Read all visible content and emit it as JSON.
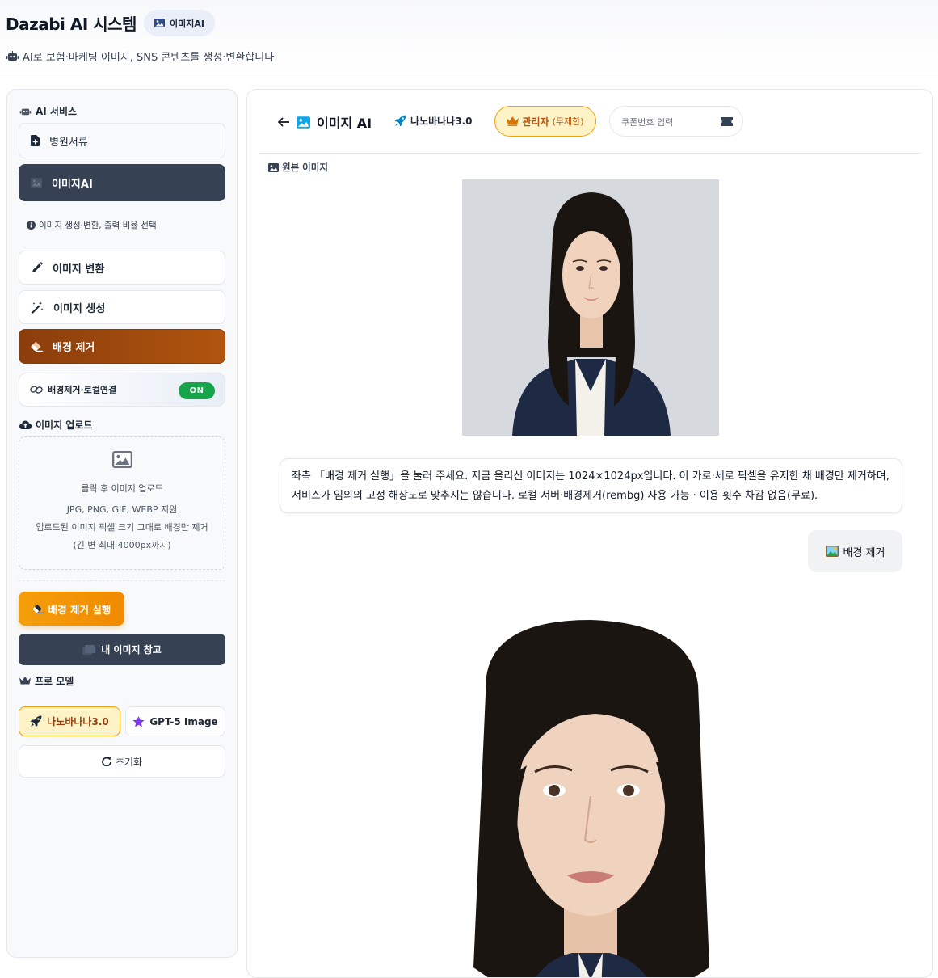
{
  "header": {
    "title": "Dazabi AI 시스템",
    "badge_label": "이미지AI",
    "subtitle": "AI로 보험·마케팅 이미지, SNS 콘텐츠를 생성·변환합니다"
  },
  "sidebar": {
    "services_label": "AI 서비스",
    "menu": {
      "hospital_docs": "병원서류",
      "image_ai": "이미지AI",
      "hint": "이미지 생성·변환, 출력 비율 선택",
      "image_convert": "이미지 변환",
      "image_generate": "이미지 생성",
      "bg_remove": "배경 제거"
    },
    "local_link": {
      "label": "배경제거·로컬연결",
      "state": "ON"
    },
    "upload": {
      "section_label": "이미지 업로드",
      "line1": "클릭 후 이미지 업로드",
      "line2": "JPG, PNG, GIF, WEBP 지원",
      "line3": "업로드된 이미지 픽셀 크기 그대로 배경만 제거",
      "line4": "(긴 변 최대 4000px까지)"
    },
    "run_button": "배경 제거 실행",
    "gallery_button": "내 이미지 창고",
    "pro_label": "프로 모델",
    "models": [
      "나노바나나3.0",
      "GPT-5 Image"
    ],
    "reset_button": "초기화"
  },
  "main": {
    "title": "이미지 AI",
    "model": "나노바나나3.0",
    "admin": {
      "label": "관리자",
      "sub": "(무제한)"
    },
    "coupon_placeholder": "쿠폰번호 입력",
    "original_label": "원본 이미지",
    "assistant_message": "좌측 「배경 제거 실행」을 눌러 주세요. 지금 올리신 이미지는 1024×1024px입니다. 이 가로·세로 픽셀을 유지한 채 배경만 제거하며, 서비스가 임의의 고정 해상도로 맞추지는 않습니다. 로컬 서버·배경제거(rembg) 사용 가능 · 이용 횟수 차감 없음(무료).",
    "user_message": "배경 제거"
  },
  "colors": {
    "dark_button": "#364154",
    "orange_active": "#8a3d0c",
    "amber": "#f59e0b",
    "toggle_on": "#16a34a",
    "admin_bg": "#fef3c7"
  }
}
